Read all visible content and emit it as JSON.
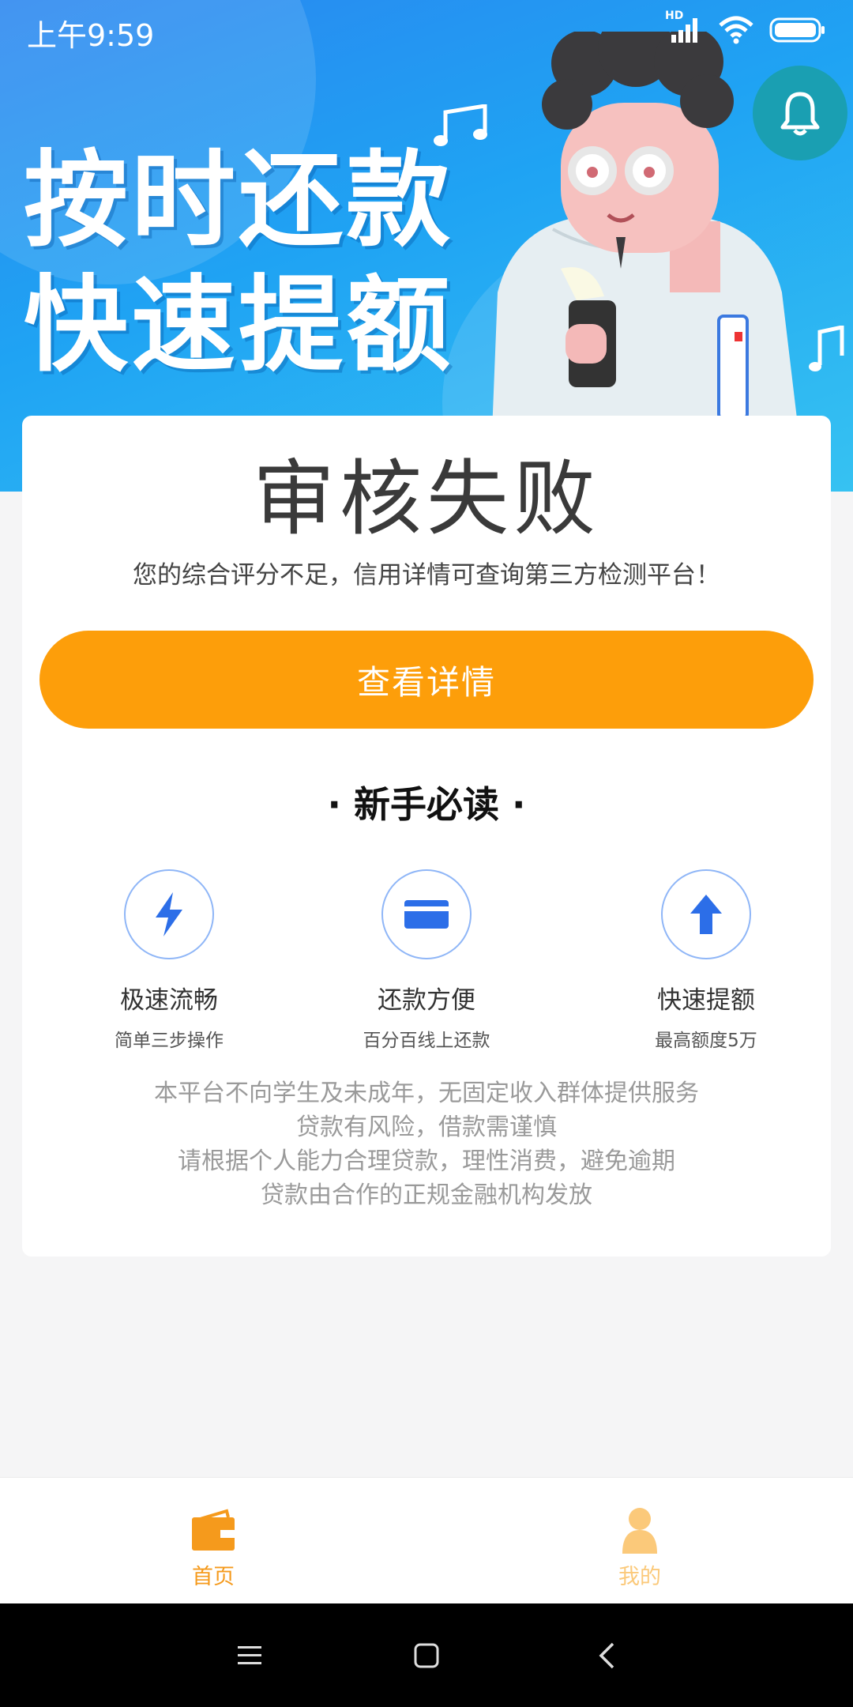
{
  "status_bar": {
    "time": "上午9:59",
    "hd_label": "HD",
    "icons": [
      "signal-icon",
      "wifi-icon",
      "battery-icon"
    ]
  },
  "banner": {
    "line1": "按时还款",
    "line2": "快速提额",
    "notification_icon": "bell-icon"
  },
  "result": {
    "title": "审核失败",
    "description": "您的综合评分不足，信用详情可查询第三方检测平台！",
    "button_label": "查看详情"
  },
  "guide": {
    "title": "· 新手必读 ·",
    "features": [
      {
        "icon": "lightning-icon",
        "title": "极速流畅",
        "subtitle": "简单三步操作"
      },
      {
        "icon": "card-icon",
        "title": "还款方便",
        "subtitle": "百分百线上还款"
      },
      {
        "icon": "arrow-up-icon",
        "title": "快速提额",
        "subtitle": "最高额度5万"
      }
    ]
  },
  "notices": [
    "本平台不向学生及未成年，无固定收入群体提供服务",
    "贷款有风险，借款需谨慎",
    "请根据个人能力合理贷款，理性消费，避免逾期",
    "贷款由合作的正规金融机构发放"
  ],
  "tabbar": {
    "tabs": [
      {
        "label": "首页",
        "icon": "wallet-icon",
        "active": true
      },
      {
        "label": "我的",
        "icon": "person-icon",
        "active": false
      }
    ]
  },
  "colors": {
    "accent": "#fd9e0a",
    "tab_active": "#f59a1c",
    "tab_inactive": "#fbc97a",
    "icon_blue": "#2c6ee8"
  }
}
